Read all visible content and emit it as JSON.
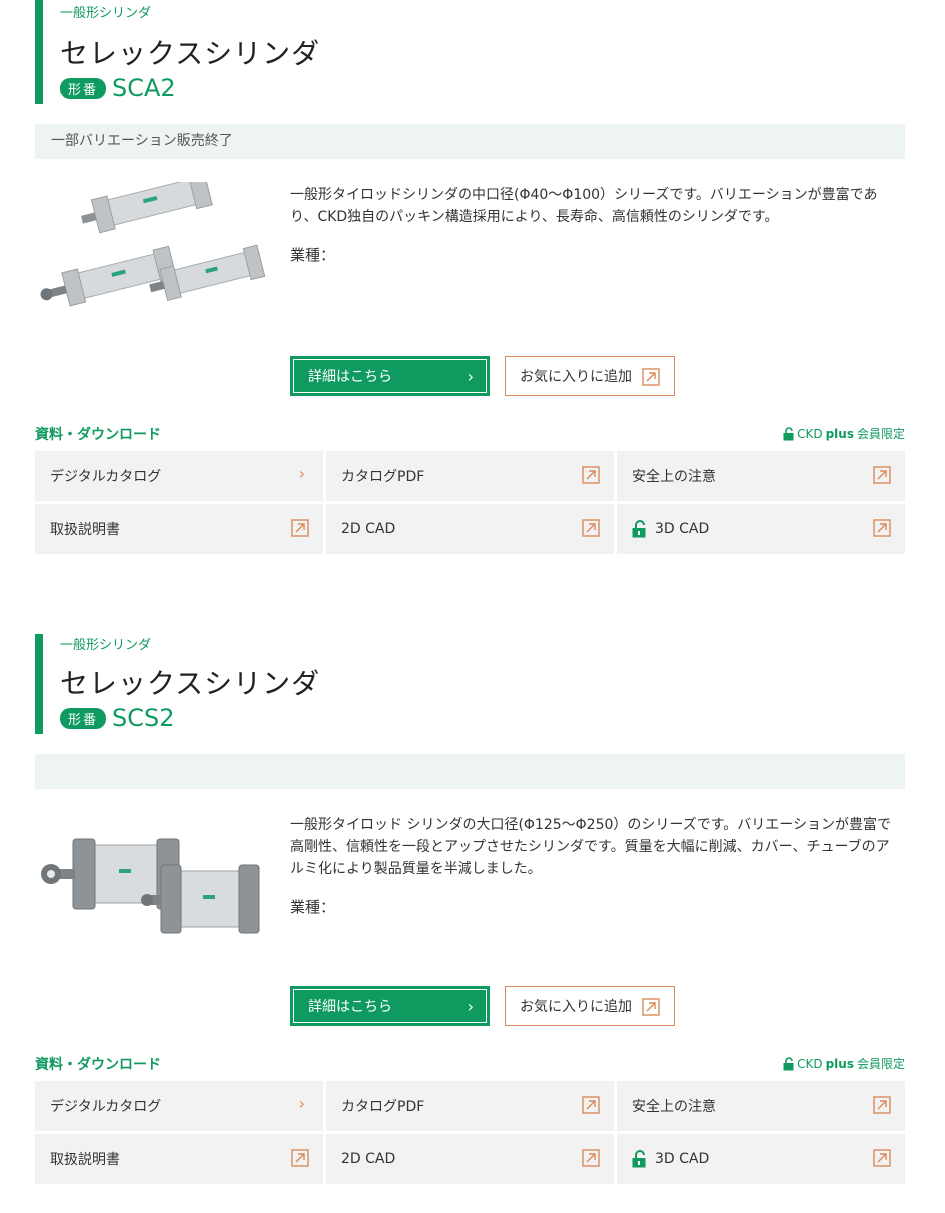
{
  "products": [
    {
      "category": "一般形シリンダ",
      "name": "セレックスシリンダ",
      "model_badge": "形番",
      "model_code": "SCA2",
      "notice": "一部バリエーション販売終了",
      "description": "一般形タイロッドシリンダの中口径(Φ40～Φ100）シリーズです。バリエーションが豊富であり、CKD独自のパッキン構造採用により、長寿命、高信頼性のシリンダです。",
      "industry_label": "業種：",
      "detail_button": "詳細はこちら",
      "favorite_button": "お気に入りに追加",
      "downloads_heading": "資料・ダウンロード",
      "plus_note_brand": "CKD",
      "plus_note_plus": "plus",
      "plus_note_suffix": "会員限定",
      "downloads": [
        "デジタルカタログ",
        "カタログPDF",
        "安全上の注意",
        "取扱説明書",
        "2D CAD",
        "3D CAD"
      ]
    },
    {
      "category": "一般形シリンダ",
      "name": "セレックスシリンダ",
      "model_badge": "形番",
      "model_code": "SCS2",
      "notice": "",
      "description": "一般形タイロッド シリンダの大口径(Φ125～Φ250）のシリーズです。バリエーションが豊富で高剛性、信頼性を一段とアップさせたシリンダです。質量を大幅に削減、カバー、チューブのアルミ化により製品質量を半減しました。",
      "industry_label": "業種：",
      "detail_button": "詳細はこちら",
      "favorite_button": "お気に入りに追加",
      "downloads_heading": "資料・ダウンロード",
      "plus_note_brand": "CKD",
      "plus_note_plus": "plus",
      "plus_note_suffix": "会員限定",
      "downloads": [
        "デジタルカタログ",
        "カタログPDF",
        "安全上の注意",
        "取扱説明書",
        "2D CAD",
        "3D CAD"
      ]
    }
  ],
  "colors": {
    "brand_green": "#0f9a5f",
    "accent_orange": "#d98a5a",
    "notice_bg": "#edf4f1",
    "cell_bg": "#f2f2f2"
  },
  "icons": {
    "external": "external-link-icon",
    "chevron": "chevron-right-icon",
    "lock": "unlock-icon"
  }
}
